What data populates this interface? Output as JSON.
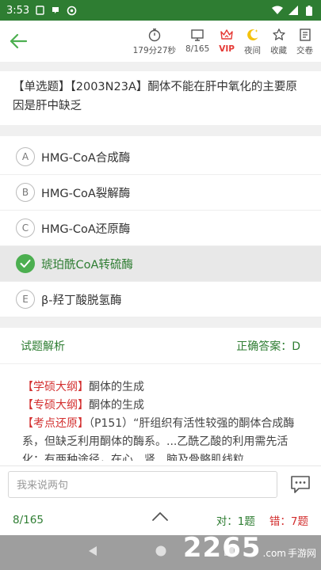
{
  "status_bar": {
    "time": "3:53"
  },
  "toolbar": {
    "timer": "179分27秒",
    "progress": "8/165",
    "vip": "VIP",
    "night": "夜间",
    "favorite": "收藏",
    "submit": "交卷"
  },
  "question": {
    "text": "【单选题】【2003N23A】酮体不能在肝中氧化的主要原因是肝中缺乏"
  },
  "options": [
    {
      "letter": "A",
      "text": "HMG-CoA合成酶"
    },
    {
      "letter": "B",
      "text": "HMG-CoA裂解酶"
    },
    {
      "letter": "C",
      "text": "HMG-CoA还原酶"
    },
    {
      "letter": "D",
      "text": "琥珀酰CoA转硫酶"
    },
    {
      "letter": "E",
      "text": "β-羟丁酸脱氢酶"
    }
  ],
  "analysis": {
    "title": "试题解析",
    "correct": "正确答案：D",
    "line1_tag": "【学硕大纲】",
    "line1_text": "酮体的生成",
    "line2_tag": "【专硕大纲】",
    "line2_text": "酮体的生成",
    "line3_tag": "【考点还原】",
    "line3_text": "（P151）“肝组织有活性较强的酮体合成酶系，但缺乏利用酮体的酶系。...乙酰乙酸的利用需先活化；有两种途径，在心、肾、脑及骨骼肌线粒"
  },
  "comment": {
    "placeholder": "我来说两句"
  },
  "bottom": {
    "pager": "8/165",
    "right": "对：1题",
    "wrong": "错：7题"
  },
  "watermark": {
    "number": "2265",
    "domain": ".com",
    "site": "手游网"
  },
  "colors": {
    "green": "#2e7d32",
    "red": "#d32f2f",
    "accent": "#4caf50"
  }
}
